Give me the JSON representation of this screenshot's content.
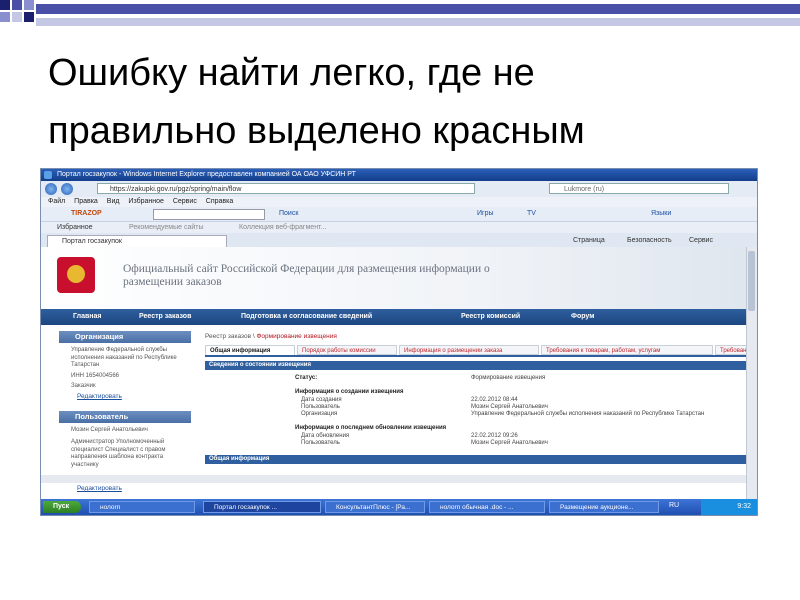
{
  "slide": {
    "title": "Ошибку найти легко, где не\nправильно выделено красным",
    "accent_colors": [
      "#4a4fa8",
      "#c5c8e4",
      "#8a8fd0"
    ]
  },
  "browser": {
    "window_title": "Портал госзакупок - Windows Internet Explorer предоставлен компанией ОА ОАО УФСИН РТ",
    "address": "https://zakupki.gov.ru/pgz/spring/main/flow",
    "search_placeholder": "Lukmore (ru)",
    "menu": [
      "Файл",
      "Правка",
      "Вид",
      "Избранное",
      "Сервис",
      "Справка"
    ],
    "toolbar": {
      "brand": "TIRAZOP",
      "search": "Поиск",
      "games": "Игры",
      "tv": "TV",
      "languages": "Языки"
    },
    "favorites": {
      "label": "Избранное",
      "item1": "Рекомендуемые сайты",
      "item2": "Коллекция веб-фрагмент..."
    },
    "tab_title": "Портал госзакупок",
    "commands": {
      "page": "Страница",
      "safety": "Безопасность",
      "service": "Сервис"
    }
  },
  "site": {
    "banner_title": "Официальный сайт Российской Федерации для размещения информации о размещении заказов",
    "nav": [
      "Главная",
      "Реестр заказов",
      "Подготовка и согласование сведений",
      "Реестр комиссий",
      "Форум"
    ],
    "org": {
      "header": "Организация",
      "name": "Управление Федеральной службы исполнения наказаний по Республике Татарстан",
      "inn": "ИНН 1654004566",
      "role": "Заказчик",
      "edit": "Редактировать"
    },
    "user": {
      "header": "Пользователь",
      "name": "Мозин Сергей Анатольевич",
      "roles": "Администратор Уполномоченный специалист Специалист с правом направления шаблона контракта участнику",
      "edit": "Редактировать"
    },
    "breadcrumb": {
      "parent": "Реестр заказов",
      "separator": "\\",
      "current": "Формирование извещения"
    },
    "tabs": [
      "Общая информация",
      "Порядок работы комиссии",
      "Информация о размещении заказа",
      "Требования к товарам, работам, услугам",
      "Требования"
    ],
    "section_state": "Сведения о состоянии извещения",
    "status_label": "Статус:",
    "status_value": "Формирование извещения",
    "created_header": "Информация о создании извещения",
    "created_rows": [
      {
        "label": "Дата создания",
        "value": "22.02.2012 08:44"
      },
      {
        "label": "Пользователь",
        "value": "Мозин Сергей Анатольевич"
      },
      {
        "label": "Организация",
        "value": "Управление Федеральной службы исполнения наказаний по Республике Татарстан"
      }
    ],
    "updated_header": "Информация о последнем обновлении извещения",
    "updated_rows": [
      {
        "label": "Дата обновления",
        "value": "22.02.2012 09:26"
      },
      {
        "label": "Пользователь",
        "value": "Мозин Сергей Анатольевич"
      }
    ],
    "section_general": "Общая информация"
  },
  "taskbar": {
    "start": "Пуск",
    "items": [
      "нолоrn",
      "Портал госзакупок ...",
      "КонсультантПлюс - [Ра...",
      "нолоrn обычная .doc - ...",
      "Размещение аукционе..."
    ],
    "lang": "RU",
    "time": "9:32"
  }
}
